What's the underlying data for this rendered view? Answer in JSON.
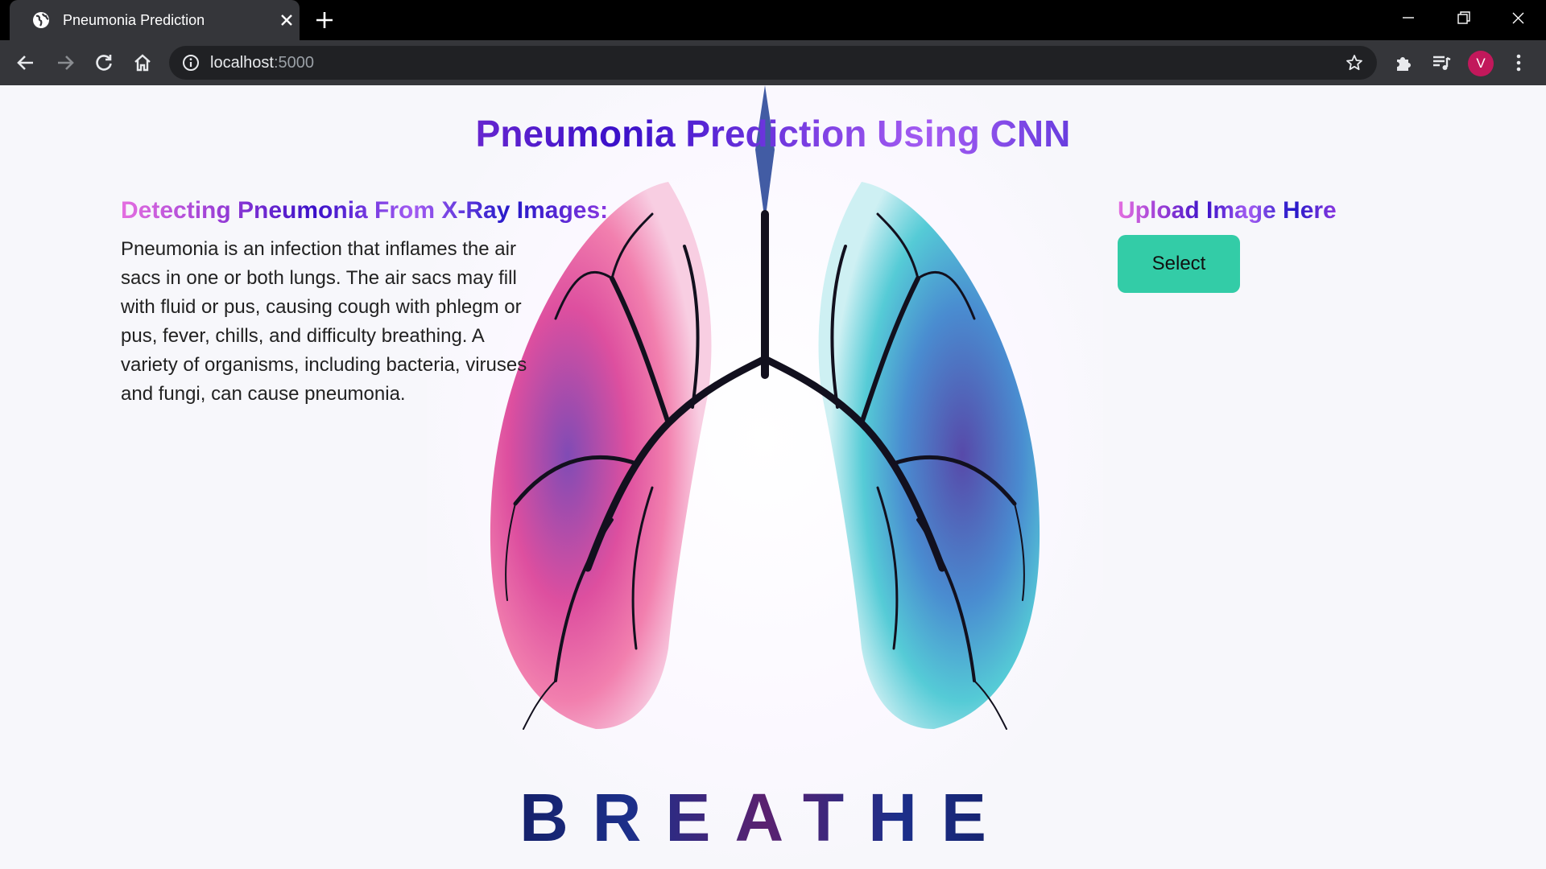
{
  "browser": {
    "tab_title": "Pneumonia Prediction",
    "url_host": "localhost",
    "url_port": ":5000",
    "profile_initial": "V",
    "icons": [
      "globe-icon",
      "close-icon",
      "plus-icon",
      "back-arrow-icon",
      "forward-arrow-icon",
      "reload-icon",
      "home-icon",
      "info-icon",
      "star-icon",
      "puzzle-icon",
      "media-icon",
      "kebab-menu-icon",
      "minimize-icon",
      "restore-icon"
    ]
  },
  "page": {
    "title": "Pneumonia Prediction Using CNN",
    "left_heading": "Detecting Pneumonia From X-Ray Images:",
    "description": "Pneumonia is an infection that inflames the air sacs in one or both lungs. The air sacs may fill with fluid or pus, causing cough with phlegm or pus, fever, chills, and difficulty breathing. A variety of organisms, including bacteria, viruses and fungi, can cause pneumonia.",
    "upload_heading": "Upload Image Here",
    "select_label": "Select",
    "hero_caption": "BREATHE"
  },
  "colors": {
    "accent_button": "#33cca7",
    "heading_gradient": [
      "#e56fe0",
      "#3a10c9",
      "#a45cf2"
    ],
    "avatar": "#c2185b"
  }
}
